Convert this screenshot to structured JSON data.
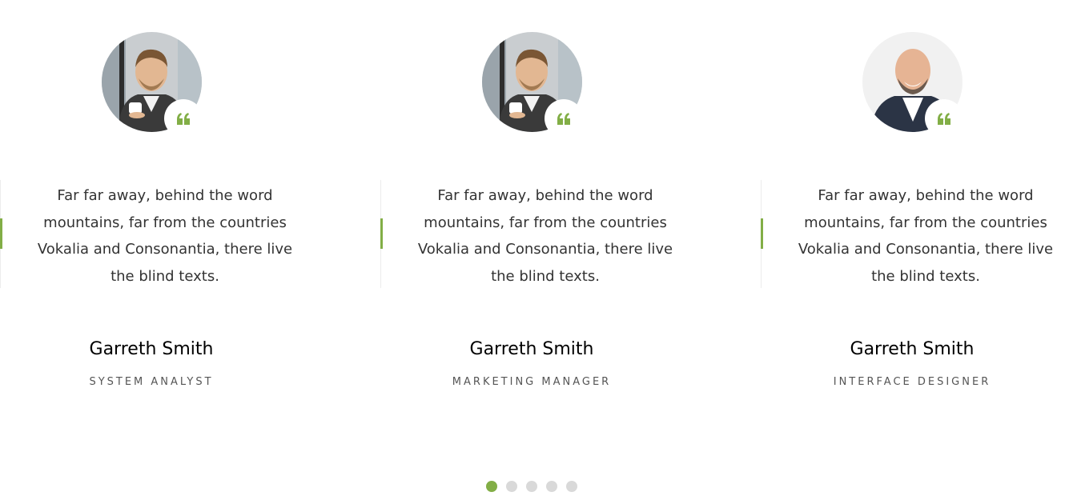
{
  "theme": {
    "accent": "#82ae46",
    "dot_inactive": "#d9d9d9",
    "text": "#333333"
  },
  "testimonials": [
    {
      "avatar_icon": "person-coffee-photo",
      "quote_icon": "quote-icon",
      "text": "Far far away, behind the word mountains, far from the countries Vokalia and Consonantia, there live the blind texts.",
      "name": "Garreth Smith",
      "role": "SYSTEM ANALYST"
    },
    {
      "avatar_icon": "person-coffee-photo",
      "quote_icon": "quote-icon",
      "text": "Far far away, behind the word mountains, far from the countries Vokalia and Consonantia, there live the blind texts.",
      "name": "Garreth Smith",
      "role": "MARKETING MANAGER"
    },
    {
      "avatar_icon": "bald-man-laughing-photo",
      "quote_icon": "quote-icon",
      "text": "Far far away, behind the word mountains, far from the countries Vokalia and Consonantia, there live the blind texts.",
      "name": "Garreth Smith",
      "role": "INTERFACE DESIGNER"
    }
  ],
  "pagination": {
    "count": 5,
    "active_index": 0
  }
}
